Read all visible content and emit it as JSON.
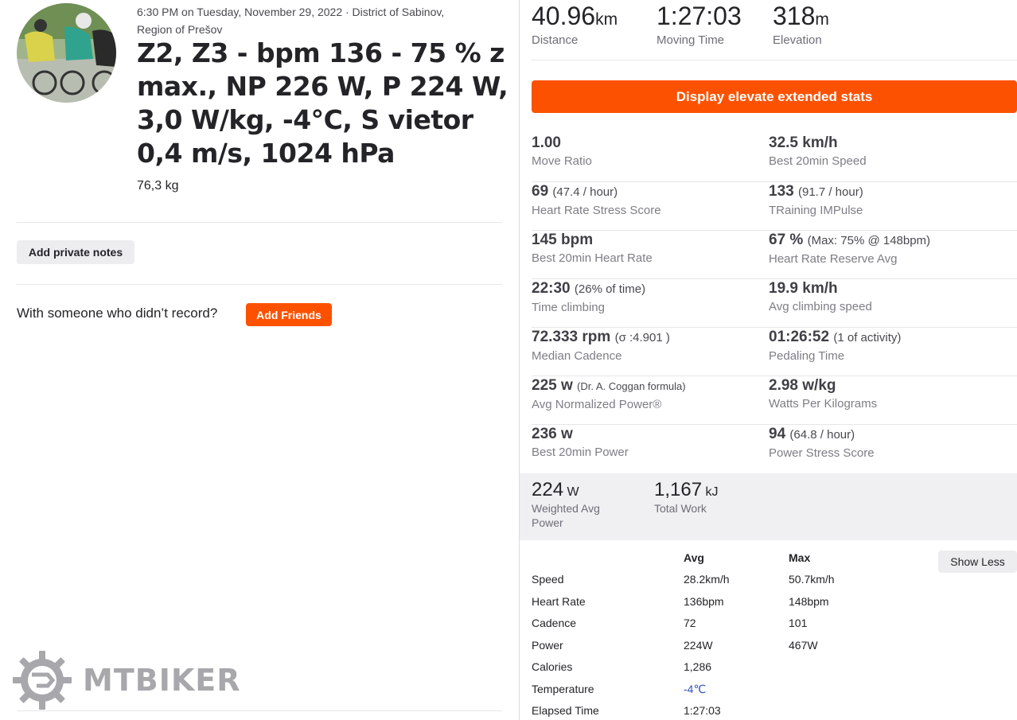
{
  "activity": {
    "meta_line1": "6:30 PM on Tuesday, November 29, 2022 · District of Sabinov,",
    "meta_line2": "Region of Prešov",
    "title": "Z2, Z3 - bpm 136 - 75 % z max., NP 226 W, P 224 W, 3,0 W/kg, -4°C, S vietor 0,4 m/s, 1024 hPa",
    "weight": "76,3 kg"
  },
  "actions": {
    "private_notes": "Add private notes",
    "friends_prompt": "With someone who didn’t record?",
    "add_friends": "Add Friends"
  },
  "logo": {
    "text": "MTBIKER"
  },
  "summary": [
    {
      "value": "40.96",
      "unit": "km",
      "label": "Distance"
    },
    {
      "value": "1:27:03",
      "unit": "",
      "label": "Moving Time"
    },
    {
      "value": "318",
      "unit": "m",
      "label": "Elevation"
    }
  ],
  "elevate_button": "Display elevate extended stats",
  "stats": [
    {
      "left": {
        "value": "1.00",
        "extra": "",
        "label": "Move Ratio"
      },
      "right": {
        "value": "32.5 km/h",
        "extra": "",
        "label": "Best 20min Speed"
      }
    },
    {
      "left": {
        "value": "69",
        "extra": "(47.4 / hour)",
        "label": "Heart Rate Stress Score"
      },
      "right": {
        "value": "133",
        "extra": "(91.7 / hour)",
        "label": "TRaining IMPulse"
      }
    },
    {
      "left": {
        "value": "145 bpm",
        "extra": "",
        "label": "Best 20min Heart Rate"
      },
      "right": {
        "value": "67 %",
        "extra": "(Max: 75% @ 148bpm)",
        "label": "Heart Rate Reserve Avg"
      }
    },
    {
      "left": {
        "value": "22:30",
        "extra": "(26% of time)",
        "label": "Time climbing"
      },
      "right": {
        "value": "19.9 km/h",
        "extra": "",
        "label": "Avg climbing speed"
      }
    },
    {
      "left": {
        "value": "72.333 rpm",
        "extra": "(σ :4.901 )",
        "label": "Median Cadence"
      },
      "right": {
        "value": "01:26:52",
        "extra": "(1 of activity)",
        "label": "Pedaling Time"
      }
    },
    {
      "left": {
        "value": "225 w",
        "extra": "(Dr. A. Coggan formula)",
        "label": "Avg Normalized Power®"
      },
      "right": {
        "value": "2.98 w/kg",
        "extra": "",
        "label": "Watts Per Kilograms"
      }
    },
    {
      "left": {
        "value": "236 w",
        "extra": "",
        "label": "Best 20min Power"
      },
      "right": {
        "value": "94",
        "extra": "(64.8 / hour)",
        "label": "Power Stress Score"
      }
    }
  ],
  "power_summary": [
    {
      "value": "224",
      "unit": "W",
      "label_line1": "Weighted Avg",
      "label_line2": "Power"
    },
    {
      "value": "1,167",
      "unit": "kJ",
      "label_line1": "Total Work",
      "label_line2": ""
    }
  ],
  "table": {
    "headers": {
      "avg": "Avg",
      "max": "Max"
    },
    "rows": [
      {
        "label": "Speed",
        "avg": "28.2km/h",
        "max": "50.7km/h"
      },
      {
        "label": "Heart Rate",
        "avg": "136bpm",
        "max": "148bpm"
      },
      {
        "label": "Cadence",
        "avg": "72",
        "max": "101"
      },
      {
        "label": "Power",
        "avg": "224W",
        "max": "467W"
      },
      {
        "label": "Calories",
        "avg": "1,286",
        "max": ""
      },
      {
        "label": "Temperature",
        "avg": "-4℃",
        "max": ""
      },
      {
        "label": "Elapsed Time",
        "avg": "1:27:03",
        "max": ""
      }
    ],
    "show_less": "Show Less"
  },
  "colors": {
    "accent": "#fc5200",
    "temperature": "#2d4fb8"
  }
}
